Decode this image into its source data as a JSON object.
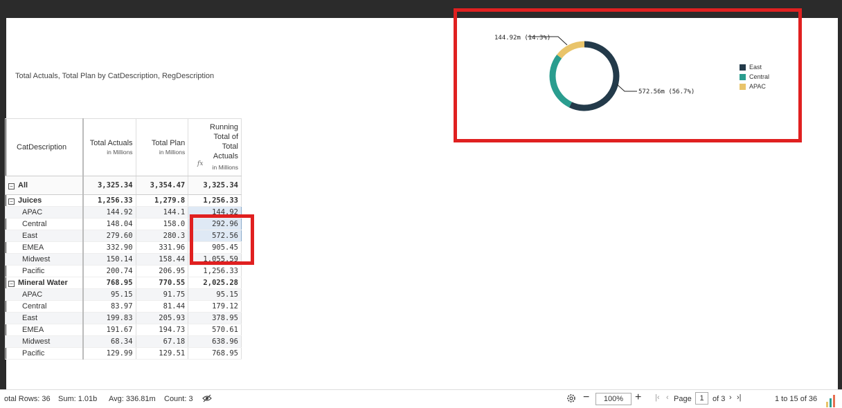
{
  "viz_title": "Total Actuals, Total Plan by CatDescription, RegDescription",
  "table": {
    "headers": {
      "cat": "CatDescription",
      "actuals": "Total Actuals",
      "actuals_sub": "in Millions",
      "plan": "Total Plan",
      "plan_sub": "in Millions",
      "running": "Running Total of Total Actuals",
      "running_sub": "in Millions",
      "fx_icon": "fx"
    },
    "rows": [
      {
        "label": "All",
        "actuals": "3,325.34",
        "plan": "3,354.47",
        "running": "3,325.34"
      },
      {
        "label": "Juices",
        "actuals": "1,256.33",
        "plan": "1,279.8",
        "running": "1,256.33"
      },
      {
        "label": "APAC",
        "actuals": "144.92",
        "plan": "144.1",
        "running": "144.92"
      },
      {
        "label": "Central",
        "actuals": "148.04",
        "plan": "158.0",
        "running": "292.96"
      },
      {
        "label": "East",
        "actuals": "279.60",
        "plan": "280.3",
        "running": "572.56"
      },
      {
        "label": "EMEA",
        "actuals": "332.90",
        "plan": "331.96",
        "running": "905.45"
      },
      {
        "label": "Midwest",
        "actuals": "150.14",
        "plan": "158.44",
        "running": "1,055.59"
      },
      {
        "label": "Pacific",
        "actuals": "200.74",
        "plan": "206.95",
        "running": "1,256.33"
      },
      {
        "label": "Mineral Water",
        "actuals": "768.95",
        "plan": "770.55",
        "running": "2,025.28"
      },
      {
        "label": "APAC",
        "actuals": "95.15",
        "plan": "91.75",
        "running": "95.15"
      },
      {
        "label": "Central",
        "actuals": "83.97",
        "plan": "81.44",
        "running": "179.12"
      },
      {
        "label": "East",
        "actuals": "199.83",
        "plan": "205.93",
        "running": "378.95"
      },
      {
        "label": "EMEA",
        "actuals": "191.67",
        "plan": "194.73",
        "running": "570.61"
      },
      {
        "label": "Midwest",
        "actuals": "68.34",
        "plan": "67.18",
        "running": "638.96"
      },
      {
        "label": "Pacific",
        "actuals": "129.99",
        "plan": "129.51",
        "running": "768.95"
      }
    ]
  },
  "chart_data": {
    "type": "pie",
    "donut": true,
    "series": [
      {
        "name": "East",
        "value": 572.56,
        "color": "#233a4a"
      },
      {
        "name": "Central",
        "value": 283.77,
        "color": "#2a9d8f"
      },
      {
        "name": "APAC",
        "value": 144.92,
        "color": "#e9c46a"
      }
    ],
    "data_labels": [
      "144.92m (14.3%)",
      "572.56m (56.7%)"
    ],
    "legend": [
      "East",
      "Central",
      "APAC"
    ],
    "legend_position": "right"
  },
  "status": {
    "total_rows": "otal Rows: 36",
    "sum": "Sum: 1.01b",
    "avg": "Avg: 336.81m",
    "count": "Count: 3",
    "zoom": "100%",
    "page_label": "Page",
    "page_num": "1",
    "page_of": "of 3",
    "range": "1 to 15 of 36"
  },
  "icons": {
    "hide": "eye-slash-icon",
    "settings": "gear-icon",
    "zoom_out": "minus-icon",
    "zoom_in": "plus-icon",
    "first": "first-page-icon",
    "prev": "prev-page-icon",
    "next": "next-page-icon",
    "last": "last-page-icon",
    "bars": "bar-chart-icon"
  }
}
